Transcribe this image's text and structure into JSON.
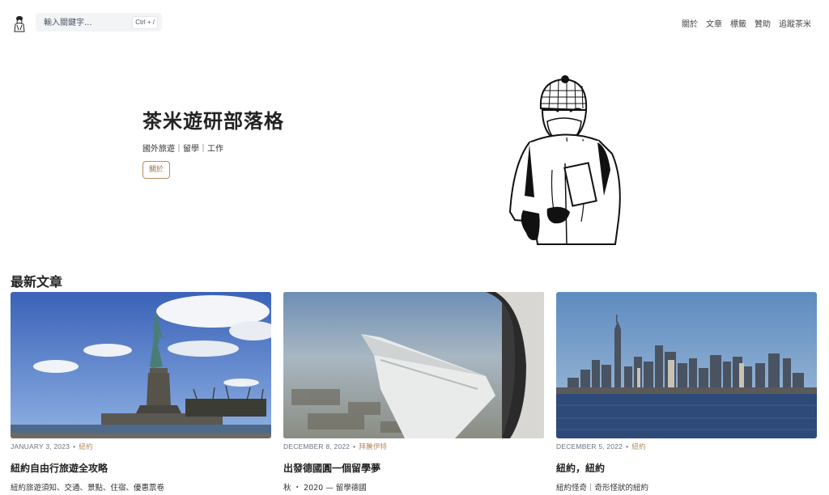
{
  "header": {
    "search": {
      "placeholder": "輸入關鍵字...",
      "shortcut": "Ctrl + /"
    },
    "nav": [
      "關於",
      "文章",
      "標籤",
      "贊助",
      "追蹤茶米"
    ]
  },
  "hero": {
    "title": "茶米遊研部落格",
    "subtitle": "國外旅遊｜留學｜工作",
    "button": "關於"
  },
  "posts": {
    "section_title": "最新文章",
    "items": [
      {
        "date": "JANUARY 3, 2023",
        "tag": "紐約",
        "title": "紐約自由行旅遊全攻略",
        "excerpt": "紐約旅遊須知、交通、景點、住宿、優惠票卷"
      },
      {
        "date": "DECEMBER 8, 2022",
        "tag": "拜騰伊特",
        "title": "出發德國圓一個留學夢",
        "excerpt": "秋 ・ 2020 — 留學德國"
      },
      {
        "date": "DECEMBER 5, 2022",
        "tag": "紐約",
        "title": "紐約，紐約",
        "excerpt": "紐約怪奇｜奇形怪狀的紐約"
      }
    ]
  },
  "colors": {
    "accent": "#b58d63",
    "text": "#222222",
    "muted": "#6b7280"
  }
}
